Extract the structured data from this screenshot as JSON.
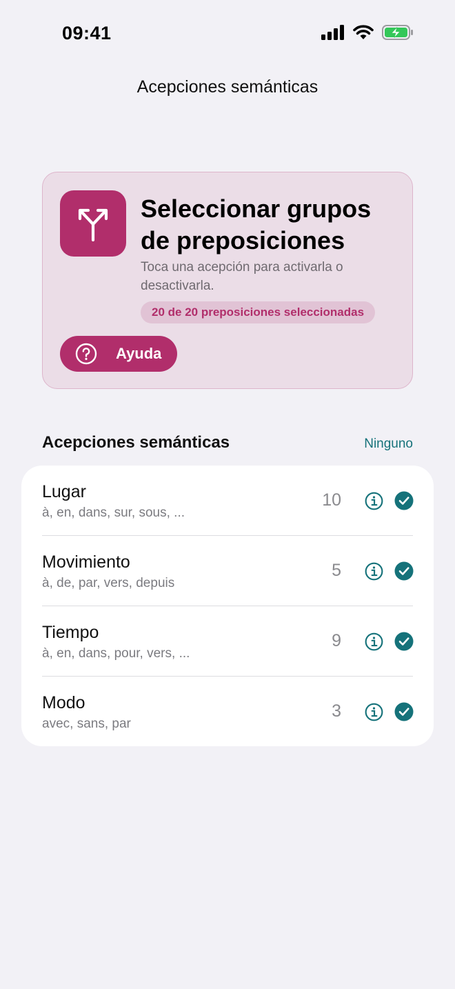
{
  "status_bar": {
    "time": "09:41"
  },
  "nav": {
    "title": "Acepciones semánticas"
  },
  "hero": {
    "icon": "split-arrow-icon",
    "title": "Seleccionar grupos de preposiciones",
    "subtitle": "Toca una acepción para activarla o desactivarla.",
    "badge": "20 de 20 preposiciones seleccionadas",
    "help_label": "Ayuda"
  },
  "section": {
    "title": "Acepciones semánticas",
    "action": "Ninguno"
  },
  "rows": [
    {
      "title": "Lugar",
      "subtitle": "à, en, dans, sur, sous, ...",
      "count": "10",
      "selected": true
    },
    {
      "title": "Movimiento",
      "subtitle": "à, de, par, vers, depuis",
      "count": "5",
      "selected": true
    },
    {
      "title": "Tiempo",
      "subtitle": "à, en, dans, pour, vers, ...",
      "count": "9",
      "selected": true
    },
    {
      "title": "Modo",
      "subtitle": "avec, sans, par",
      "count": "3",
      "selected": true
    }
  ],
  "colors": {
    "accent": "#b12e6b",
    "teal": "#15727a",
    "hero_bg": "#ebdde7",
    "battery": "#34c759"
  }
}
